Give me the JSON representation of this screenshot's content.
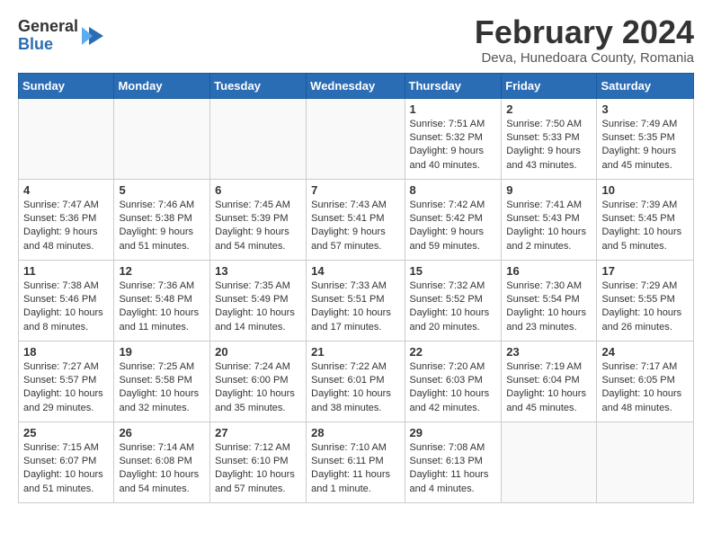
{
  "logo": {
    "general": "General",
    "blue": "Blue"
  },
  "title": {
    "month_year": "February 2024",
    "location": "Deva, Hunedoara County, Romania"
  },
  "headers": [
    "Sunday",
    "Monday",
    "Tuesday",
    "Wednesday",
    "Thursday",
    "Friday",
    "Saturday"
  ],
  "weeks": [
    [
      {
        "day": "",
        "info": ""
      },
      {
        "day": "",
        "info": ""
      },
      {
        "day": "",
        "info": ""
      },
      {
        "day": "",
        "info": ""
      },
      {
        "day": "1",
        "info": "Sunrise: 7:51 AM\nSunset: 5:32 PM\nDaylight: 9 hours\nand 40 minutes."
      },
      {
        "day": "2",
        "info": "Sunrise: 7:50 AM\nSunset: 5:33 PM\nDaylight: 9 hours\nand 43 minutes."
      },
      {
        "day": "3",
        "info": "Sunrise: 7:49 AM\nSunset: 5:35 PM\nDaylight: 9 hours\nand 45 minutes."
      }
    ],
    [
      {
        "day": "4",
        "info": "Sunrise: 7:47 AM\nSunset: 5:36 PM\nDaylight: 9 hours\nand 48 minutes."
      },
      {
        "day": "5",
        "info": "Sunrise: 7:46 AM\nSunset: 5:38 PM\nDaylight: 9 hours\nand 51 minutes."
      },
      {
        "day": "6",
        "info": "Sunrise: 7:45 AM\nSunset: 5:39 PM\nDaylight: 9 hours\nand 54 minutes."
      },
      {
        "day": "7",
        "info": "Sunrise: 7:43 AM\nSunset: 5:41 PM\nDaylight: 9 hours\nand 57 minutes."
      },
      {
        "day": "8",
        "info": "Sunrise: 7:42 AM\nSunset: 5:42 PM\nDaylight: 9 hours\nand 59 minutes."
      },
      {
        "day": "9",
        "info": "Sunrise: 7:41 AM\nSunset: 5:43 PM\nDaylight: 10 hours\nand 2 minutes."
      },
      {
        "day": "10",
        "info": "Sunrise: 7:39 AM\nSunset: 5:45 PM\nDaylight: 10 hours\nand 5 minutes."
      }
    ],
    [
      {
        "day": "11",
        "info": "Sunrise: 7:38 AM\nSunset: 5:46 PM\nDaylight: 10 hours\nand 8 minutes."
      },
      {
        "day": "12",
        "info": "Sunrise: 7:36 AM\nSunset: 5:48 PM\nDaylight: 10 hours\nand 11 minutes."
      },
      {
        "day": "13",
        "info": "Sunrise: 7:35 AM\nSunset: 5:49 PM\nDaylight: 10 hours\nand 14 minutes."
      },
      {
        "day": "14",
        "info": "Sunrise: 7:33 AM\nSunset: 5:51 PM\nDaylight: 10 hours\nand 17 minutes."
      },
      {
        "day": "15",
        "info": "Sunrise: 7:32 AM\nSunset: 5:52 PM\nDaylight: 10 hours\nand 20 minutes."
      },
      {
        "day": "16",
        "info": "Sunrise: 7:30 AM\nSunset: 5:54 PM\nDaylight: 10 hours\nand 23 minutes."
      },
      {
        "day": "17",
        "info": "Sunrise: 7:29 AM\nSunset: 5:55 PM\nDaylight: 10 hours\nand 26 minutes."
      }
    ],
    [
      {
        "day": "18",
        "info": "Sunrise: 7:27 AM\nSunset: 5:57 PM\nDaylight: 10 hours\nand 29 minutes."
      },
      {
        "day": "19",
        "info": "Sunrise: 7:25 AM\nSunset: 5:58 PM\nDaylight: 10 hours\nand 32 minutes."
      },
      {
        "day": "20",
        "info": "Sunrise: 7:24 AM\nSunset: 6:00 PM\nDaylight: 10 hours\nand 35 minutes."
      },
      {
        "day": "21",
        "info": "Sunrise: 7:22 AM\nSunset: 6:01 PM\nDaylight: 10 hours\nand 38 minutes."
      },
      {
        "day": "22",
        "info": "Sunrise: 7:20 AM\nSunset: 6:03 PM\nDaylight: 10 hours\nand 42 minutes."
      },
      {
        "day": "23",
        "info": "Sunrise: 7:19 AM\nSunset: 6:04 PM\nDaylight: 10 hours\nand 45 minutes."
      },
      {
        "day": "24",
        "info": "Sunrise: 7:17 AM\nSunset: 6:05 PM\nDaylight: 10 hours\nand 48 minutes."
      }
    ],
    [
      {
        "day": "25",
        "info": "Sunrise: 7:15 AM\nSunset: 6:07 PM\nDaylight: 10 hours\nand 51 minutes."
      },
      {
        "day": "26",
        "info": "Sunrise: 7:14 AM\nSunset: 6:08 PM\nDaylight: 10 hours\nand 54 minutes."
      },
      {
        "day": "27",
        "info": "Sunrise: 7:12 AM\nSunset: 6:10 PM\nDaylight: 10 hours\nand 57 minutes."
      },
      {
        "day": "28",
        "info": "Sunrise: 7:10 AM\nSunset: 6:11 PM\nDaylight: 11 hours\nand 1 minute."
      },
      {
        "day": "29",
        "info": "Sunrise: 7:08 AM\nSunset: 6:13 PM\nDaylight: 11 hours\nand 4 minutes."
      },
      {
        "day": "",
        "info": ""
      },
      {
        "day": "",
        "info": ""
      }
    ]
  ]
}
